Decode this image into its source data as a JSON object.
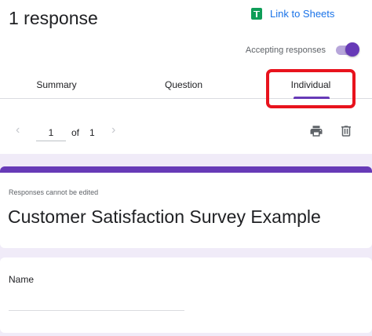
{
  "header": {
    "title": "1 response",
    "link_sheets_label": "Link to Sheets",
    "link_sheets_icon": "google-sheets-icon",
    "accepting_label": "Accepting responses",
    "accepting_enabled": true
  },
  "tabs": [
    {
      "label": "Summary",
      "active": false
    },
    {
      "label": "Question",
      "active": false
    },
    {
      "label": "Individual",
      "active": true
    }
  ],
  "pager": {
    "prev_icon": "chevron-left-icon",
    "next_icon": "chevron-right-icon",
    "current_page": "1",
    "of_label": "of",
    "total_pages": "1",
    "print_icon": "print-icon",
    "delete_icon": "trash-icon"
  },
  "form": {
    "note": "Responses cannot be edited",
    "title": "Customer Satisfaction Survey Example",
    "questions": [
      {
        "label": "Name",
        "value": ""
      }
    ]
  },
  "colors": {
    "accent": "#673ab7",
    "link": "#1a73e8",
    "highlight": "#e8131d",
    "background": "#f0ebf8"
  }
}
